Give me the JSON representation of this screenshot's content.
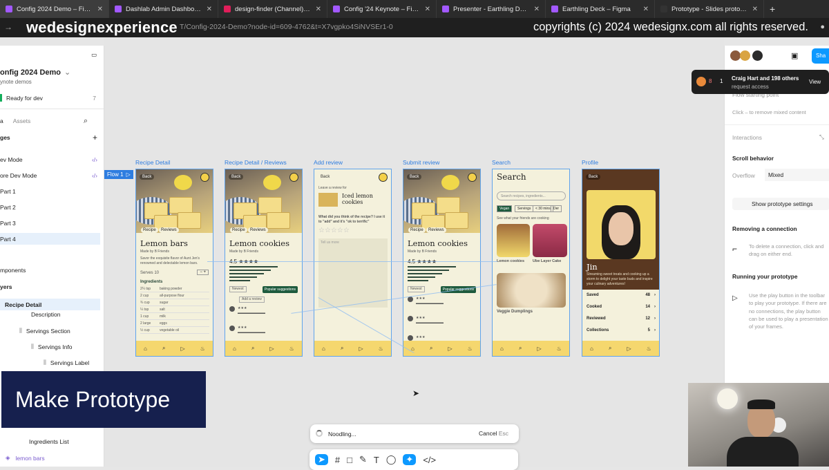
{
  "browser": {
    "tabs": [
      {
        "title": "Config 2024 Demo – Figma",
        "color": "#a259ff",
        "active": true
      },
      {
        "title": "Dashlab Admin Dashboard UI",
        "color": "#a259ff"
      },
      {
        "title": "design-finder (Channel) - UI",
        "color": "#e01e5a"
      },
      {
        "title": "Config '24 Keynote – Figma",
        "color": "#a259ff"
      },
      {
        "title": "Presenter - Earthling Deck - F",
        "color": "#a259ff"
      },
      {
        "title": "Earthling Deck – Figma",
        "color": "#a259ff"
      },
      {
        "title": "Prototype - Slides prototype",
        "color": "#333333"
      }
    ],
    "new_tab": "+",
    "url": "T/Config-2024-Demo?node-id=609-4762&t=X7vgpko4SiNVSEr1-0"
  },
  "watermark": {
    "brand": "wedesignexperience",
    "copyright": "copyrights (c) 2024 wedesignx.com all rights reserved."
  },
  "left_panel": {
    "file_name": "onfig 2024 Demo",
    "subtitle": "ynote demos",
    "ready_label": "Ready for dev",
    "ready_count": "7",
    "tabs": [
      "a",
      "Assets"
    ],
    "pages_header": "ges",
    "pages": [
      "ev Mode",
      "ore Dev Mode",
      "Part 1",
      "Part 2",
      "Part 3",
      "Part 4"
    ],
    "components_header": "mponents",
    "layers_header": "yers",
    "layers": [
      "Recipe Detail",
      "Description",
      "Servings Section",
      "Servings Info",
      "Servings Label"
    ],
    "bottom_layers": [
      "Ingredients List",
      "lemon bars"
    ]
  },
  "canvas": {
    "flow_label": "Flow 1",
    "frames": [
      {
        "label": "Recipe Detail",
        "title": "Lemon bars"
      },
      {
        "label": "Recipe Detail / Reviews",
        "title": "Lemon cookies"
      },
      {
        "label": "Add review",
        "title": "Iced lemon cookies"
      },
      {
        "label": "Submit review",
        "title": "Lemon cookies"
      },
      {
        "label": "Search",
        "title": "Search"
      },
      {
        "label": "Profile",
        "title": "Jin"
      }
    ],
    "recipe": {
      "back": "Back",
      "tab_recipe": "Recipe",
      "tab_reviews": "Reviews",
      "made_by": "Made by B Friends",
      "desc": "Savor the exquisite flavor of Aunt Jen's renowned and delectable lemon bars.",
      "serves": "Serves 10",
      "ingredients_header": "Ingredients",
      "ingredients": [
        [
          "2¼ tsp",
          "baking powder"
        ],
        [
          "2 cup",
          "all-purpose flour"
        ],
        [
          "¾ cup",
          "sugar"
        ],
        [
          "¼ tsp",
          "salt"
        ],
        [
          "1 cup",
          "milk"
        ],
        [
          "2 large",
          "eggs"
        ],
        [
          "½ cup",
          "vegetable oil"
        ]
      ]
    },
    "reviews": {
      "rating": "4.5",
      "newest": "Newest",
      "popular": "Popular suggestions",
      "add_review": "Add a review"
    },
    "add_review": {
      "leave_review": "Leave a review for",
      "question": "What did you think of the recipe? I use it to \"add\" and it's \"ok to terrific\"",
      "placeholder": "Tell us more",
      "submit": "Submit review"
    },
    "search": {
      "title": "Search",
      "placeholder": "Search recipes, ingredients...",
      "chips": [
        "Vegan",
        "Servings",
        "< 30 mins",
        "Der"
      ],
      "friends_cooking": "See what your friends are cooking",
      "item1": "Lemon cookies",
      "item2": "Ube Layer Cake",
      "item3": "Veggie Dumplings"
    },
    "profile": {
      "name": "Jin",
      "bio": "Streaming sweet treats and cooking up a storm to delight your taste buds and inspire your culinary adventures!",
      "rows": [
        [
          "Saved",
          "48"
        ],
        [
          "Cooked",
          "14"
        ],
        [
          "Reviewed",
          "12"
        ],
        [
          "Collections",
          "5"
        ]
      ]
    }
  },
  "right_panel": {
    "share": "Sha",
    "toast_count": "8",
    "toast_count2": "1",
    "toast_title": "Craig Hart and 198 others",
    "toast_sub": "request access",
    "toast_view": "View",
    "flow_start": "Flow starting point",
    "flow_hint": "Click – to remove mixed content",
    "interactions": "Interactions",
    "scroll_behavior": "Scroll behavior",
    "overflow": "Overflow",
    "overflow_value": "Mixed",
    "show_settings": "Show prototype settings",
    "removing": "Removing a connection",
    "removing_text": "To delete a connection, click and drag on either end.",
    "running": "Running your prototype",
    "running_text": "Use the play button in the toolbar to play your prototype. If there are no connections, the play button can be used to play a presentation of your frames."
  },
  "overlay": {
    "make_prototype": "Make Prototype"
  },
  "noodle": {
    "status": "Noodling...",
    "cancel": "Cancel",
    "esc": "Esc"
  }
}
